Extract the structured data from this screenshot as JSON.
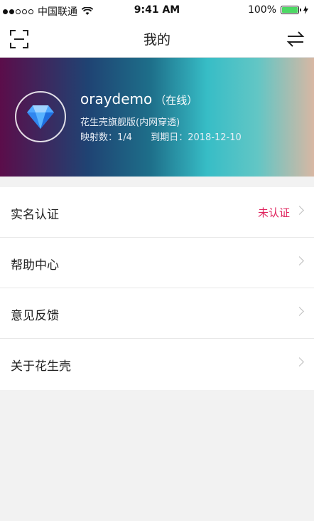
{
  "status_bar": {
    "carrier": "中国联通",
    "time": "9:41 AM",
    "battery": "100%"
  },
  "nav": {
    "title": "我的",
    "left_icon": "scan-icon",
    "right_icon": "switch-arrows-icon"
  },
  "profile": {
    "username": "oraydemo",
    "online_status": "（在线）",
    "plan": "花生壳旗舰版(内网穿透)",
    "mapping_label": "映射数：",
    "mapping_value": "1/4",
    "expiry_label": "到期日：",
    "expiry_value": "2018-12-10",
    "avatar_icon": "diamond-icon"
  },
  "menu": {
    "items": [
      {
        "label": "实名认证",
        "badge": "未认证"
      },
      {
        "label": "帮助中心"
      },
      {
        "label": "意见反馈"
      },
      {
        "label": "关于花生壳"
      }
    ]
  },
  "colors": {
    "accent_badge": "#e0245e",
    "battery_fill": "#4cd964"
  }
}
